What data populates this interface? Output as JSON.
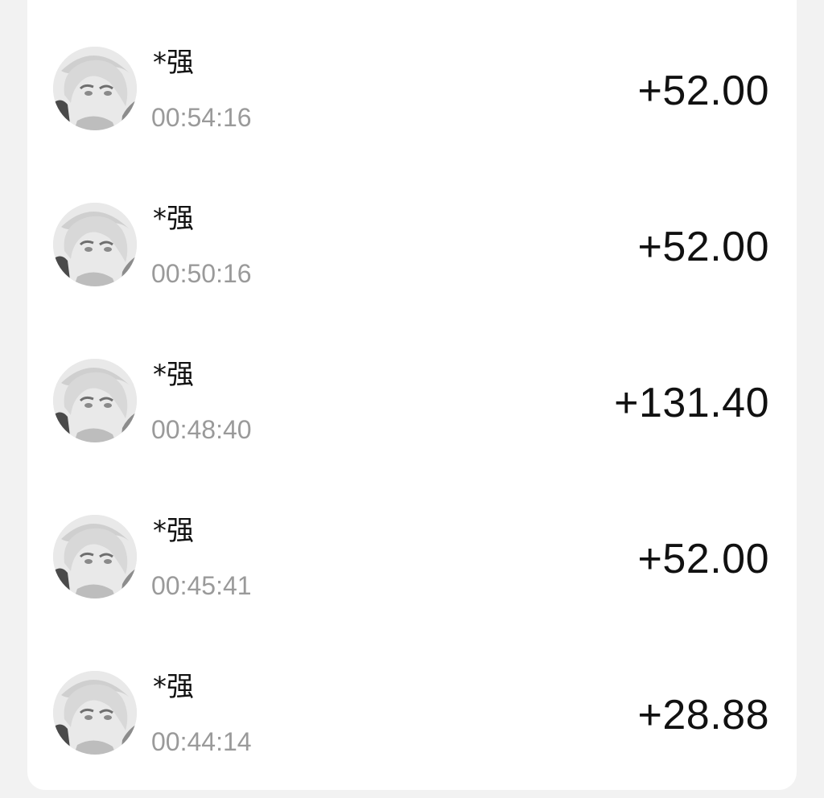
{
  "transactions": [
    {
      "payer": "*强",
      "time": "00:54:16",
      "amount": "+52.00",
      "avatar": "user-avatar-icon"
    },
    {
      "payer": "*强",
      "time": "00:50:16",
      "amount": "+52.00",
      "avatar": "user-avatar-icon"
    },
    {
      "payer": "*强",
      "time": "00:48:40",
      "amount": "+131.40",
      "avatar": "user-avatar-icon"
    },
    {
      "payer": "*强",
      "time": "00:45:41",
      "amount": "+52.00",
      "avatar": "user-avatar-icon"
    },
    {
      "payer": "*强",
      "time": "00:44:14",
      "amount": "+28.88",
      "avatar": "user-avatar-icon"
    }
  ],
  "colors": {
    "background": "#f2f2f2",
    "card": "#ffffff",
    "amount": "#111111",
    "time": "#9a9a9a"
  }
}
